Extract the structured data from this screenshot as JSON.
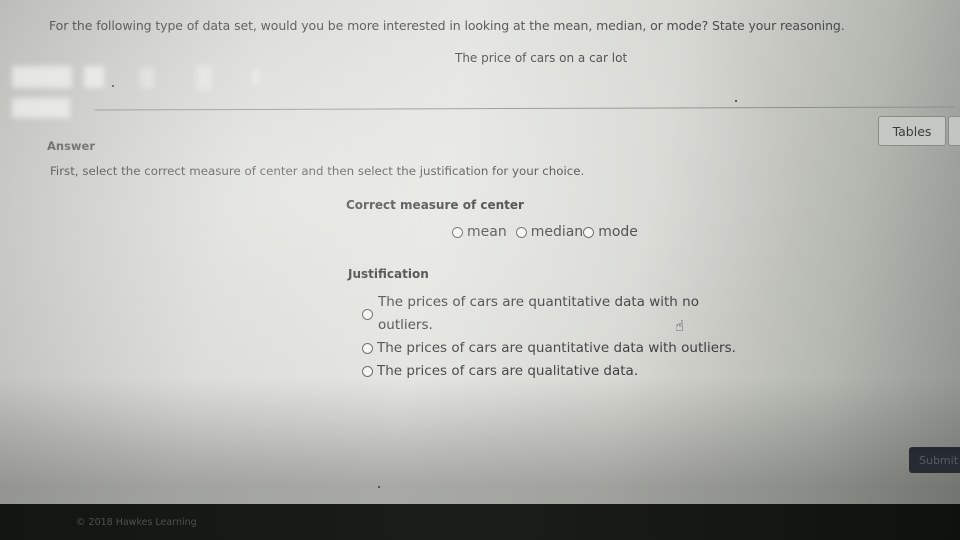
{
  "question": {
    "prompt": "For the following type of data set, would you be more interested in looking at the mean, median, or mode? State your reasoning.",
    "dataset": "The price of cars on a car lot"
  },
  "toolbar": {
    "tables_label": "Tables"
  },
  "answer": {
    "heading": "Answer",
    "instructions": "First, select the correct measure of center and then select the justification for your choice.",
    "measure_title": "Correct measure of center",
    "measure_options": [
      {
        "label": "mean",
        "selected": false
      },
      {
        "label": "median",
        "selected": false
      },
      {
        "label": "mode",
        "selected": false
      }
    ],
    "justification_title": "Justification",
    "justification_options": [
      {
        "label": "The prices of cars are quantitative data with no outliers.",
        "selected": false
      },
      {
        "label": "The prices of cars are quantitative data with outliers.",
        "selected": false
      },
      {
        "label": "The prices of cars are qualitative data.",
        "selected": false
      }
    ]
  },
  "actions": {
    "submit_label": "Submit"
  },
  "footer": {
    "copyright": "© 2018 Hawkes Learning"
  }
}
